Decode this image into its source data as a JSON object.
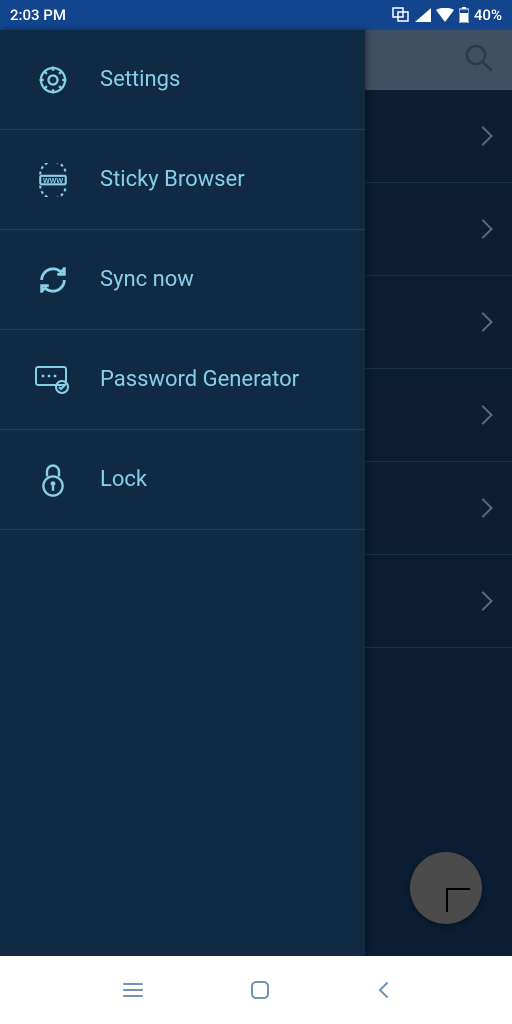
{
  "status": {
    "time": "2:03 PM",
    "battery_pct": "40%"
  },
  "drawer": {
    "items": [
      {
        "label": "Settings"
      },
      {
        "label": "Sticky Browser"
      },
      {
        "label": "Sync now"
      },
      {
        "label": "Password Generator"
      },
      {
        "label": "Lock"
      }
    ]
  },
  "colors": {
    "accent": "#87CFE9",
    "drawer_bg": "#112A44",
    "app_bg": "#0B1E33",
    "status_bg": "#12458E"
  }
}
